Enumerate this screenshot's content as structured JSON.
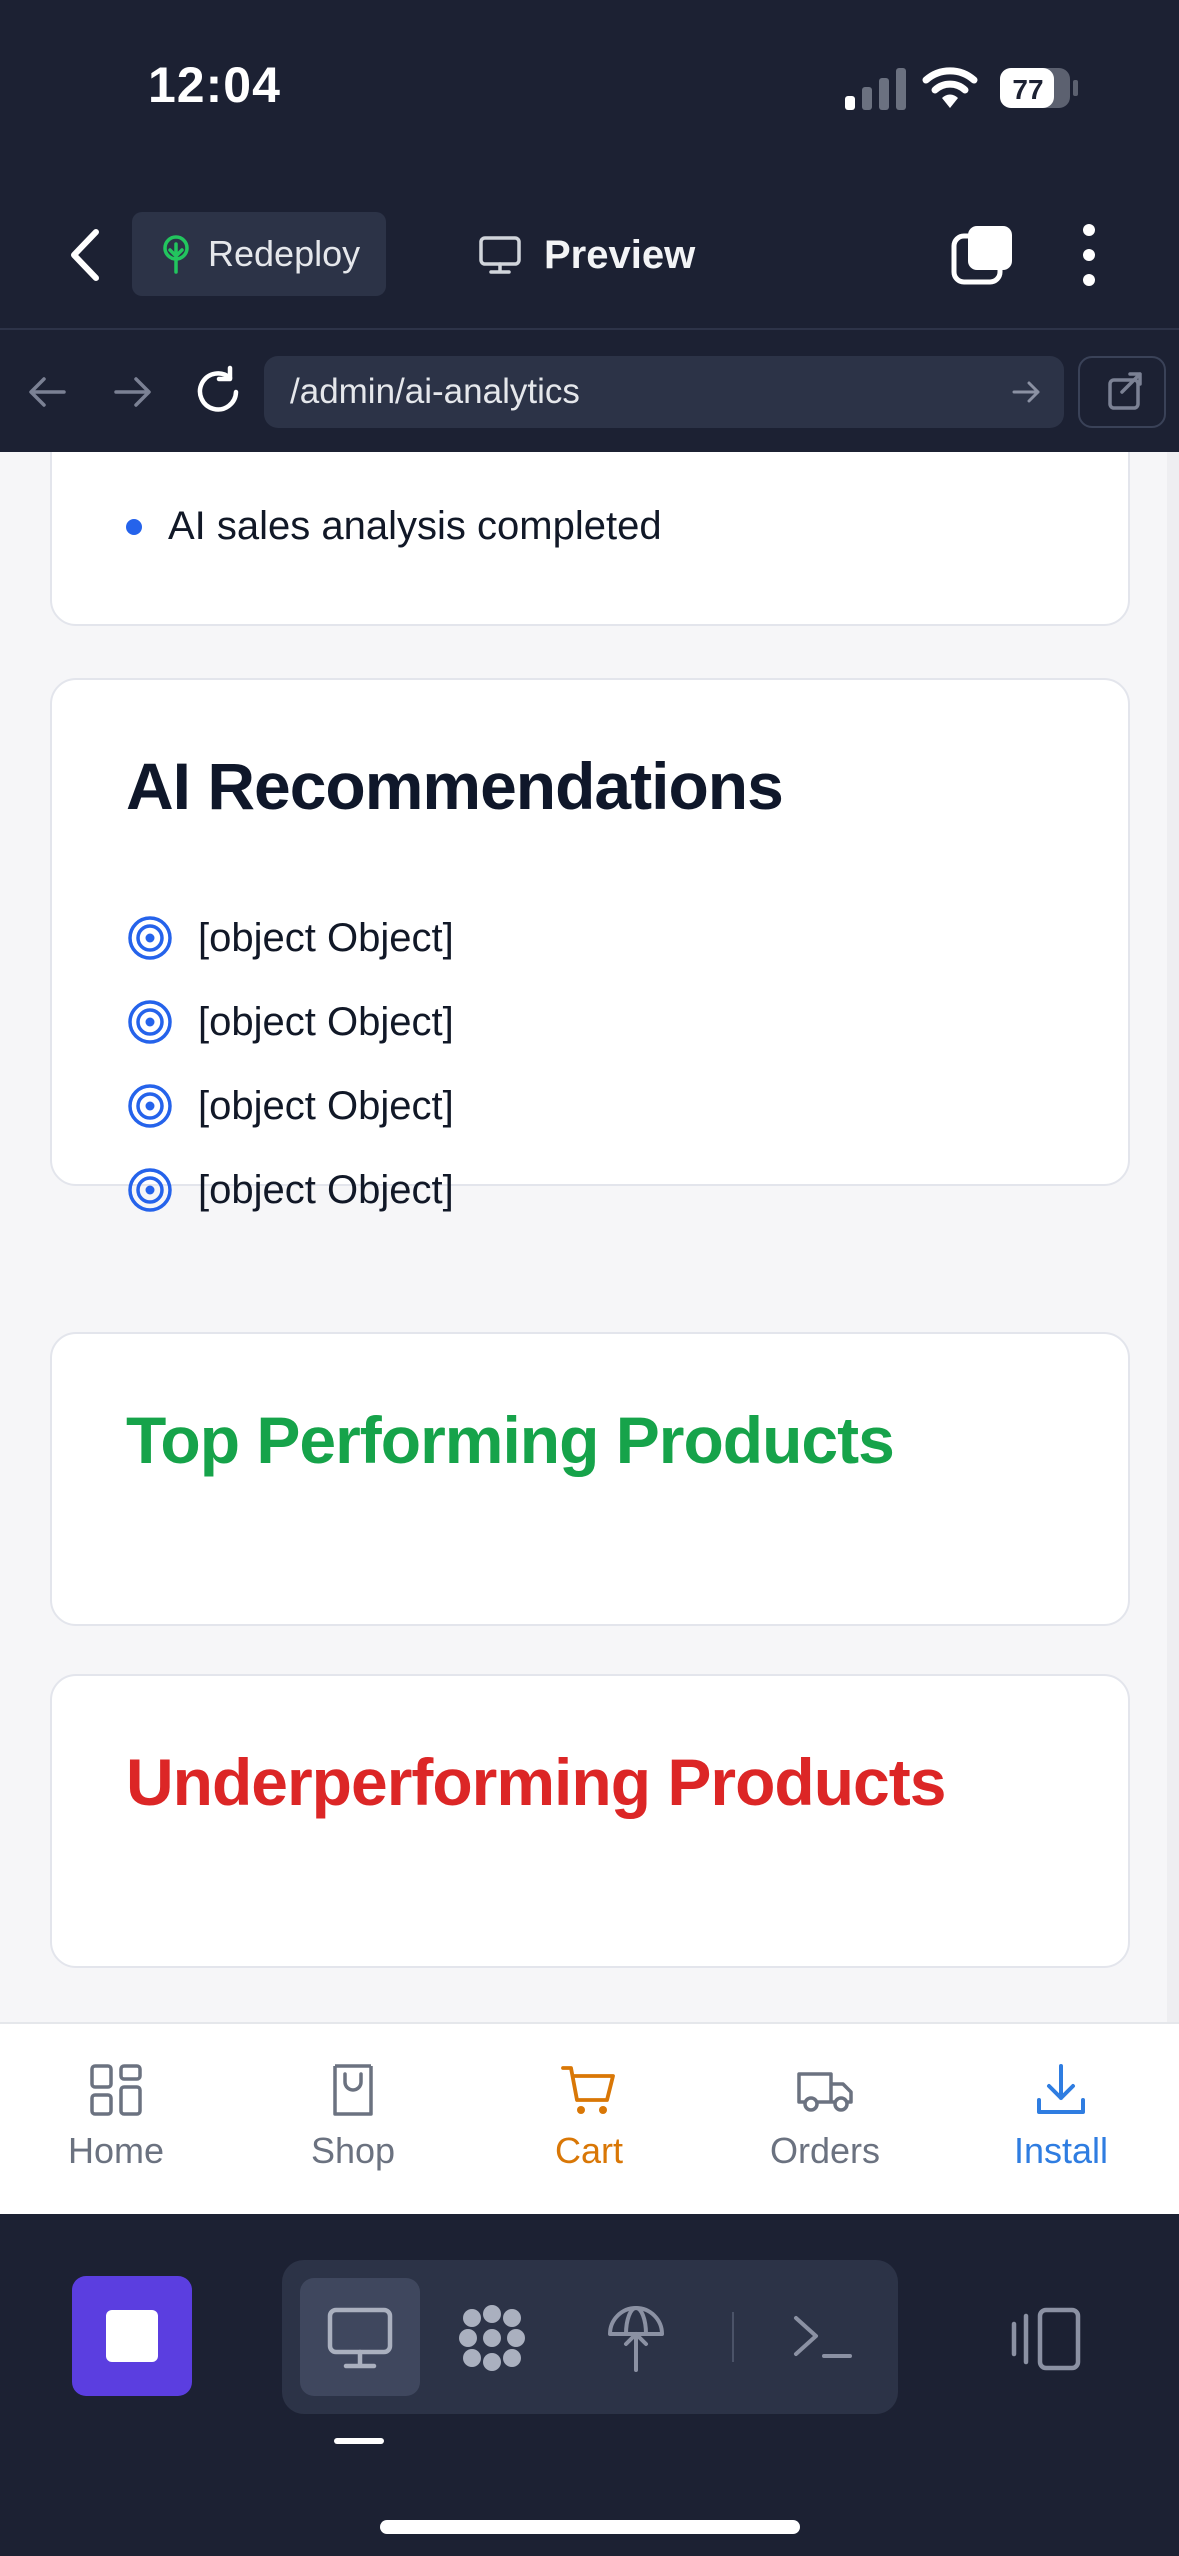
{
  "status_bar": {
    "time": "12:04",
    "battery": "77"
  },
  "header": {
    "redeploy_label": "Redeploy",
    "preview_label": "Preview"
  },
  "browser": {
    "url": "/admin/ai-analytics"
  },
  "activity": {
    "item": "AI sales analysis completed"
  },
  "recommendations": {
    "title": "AI Recommendations",
    "items": [
      "[object Object]",
      "[object Object]",
      "[object Object]",
      "[object Object]"
    ]
  },
  "top_products": {
    "title": "Top Performing Products"
  },
  "under_products": {
    "title": "Underperforming Products"
  },
  "bottom_nav": {
    "home": "Home",
    "shop": "Shop",
    "cart": "Cart",
    "orders": "Orders",
    "install": "Install"
  },
  "colors": {
    "accent_blue": "#2563eb",
    "green": "#16a34a",
    "red": "#dc2626",
    "cart_orange": "#d97706",
    "stop_purple": "#5b3ee0"
  },
  "icons": {
    "recommendation": "target-icon",
    "home": "grid-icon",
    "shop": "store-icon",
    "cart": "cart-icon",
    "orders": "truck-icon",
    "install": "download-icon"
  }
}
